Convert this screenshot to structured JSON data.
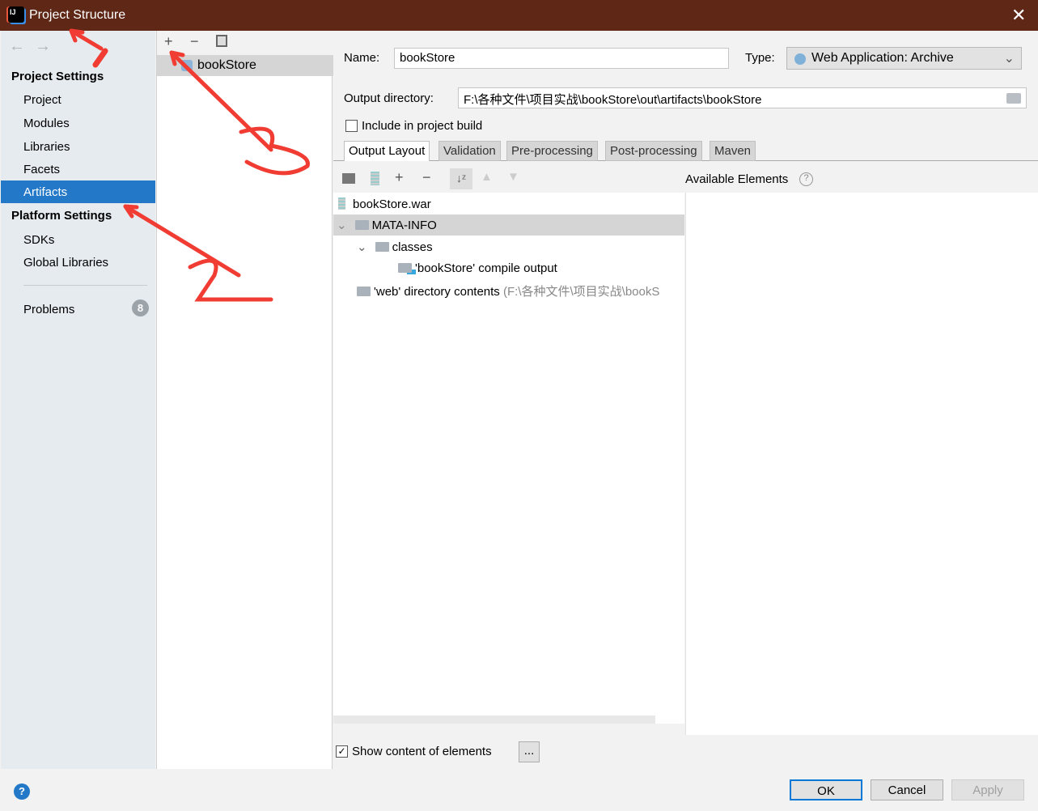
{
  "window": {
    "title": "Project Structure",
    "logo_text": "IJ"
  },
  "nav": {
    "back_icon": "arrow-left-icon",
    "forward_icon": "arrow-right-icon"
  },
  "sidebar": {
    "project_settings": "Project Settings",
    "project_items": [
      {
        "label": "Project"
      },
      {
        "label": "Modules"
      },
      {
        "label": "Libraries"
      },
      {
        "label": "Facets"
      },
      {
        "label": "Artifacts",
        "selected": true
      }
    ],
    "platform_settings": "Platform Settings",
    "platform_items": [
      {
        "label": "SDKs"
      },
      {
        "label": "Global Libraries"
      }
    ],
    "problems": {
      "label": "Problems",
      "count": "8"
    }
  },
  "artifacts_list": {
    "items": [
      {
        "label": "bookStore",
        "selected": true
      }
    ]
  },
  "artifact": {
    "name_label": "Name:",
    "name_value": "bookStore",
    "type_label": "Type:",
    "type_value": "Web Application: Archive",
    "output_dir_label": "Output directory:",
    "output_dir_value": "F:\\各种文件\\项目实战\\bookStore\\out\\artifacts\\bookStore",
    "include_build_label": "Include in project build",
    "include_build_checked": false
  },
  "tabs": [
    {
      "label": "Output Layout",
      "selected": true
    },
    {
      "label": "Validation"
    },
    {
      "label": "Pre-processing"
    },
    {
      "label": "Post-processing"
    },
    {
      "label": "Maven"
    }
  ],
  "layout": {
    "available_elements": "Available Elements",
    "tree": [
      {
        "label": "bookStore.war"
      },
      {
        "label": "MATA-INFO",
        "selected": true,
        "expanded": true
      },
      {
        "label": "classes",
        "expanded": true
      },
      {
        "label": "'bookStore' compile output"
      },
      {
        "label": "'web' directory contents",
        "hint": "(F:\\各种文件\\项目实战\\bookS"
      }
    ],
    "show_content_label": "Show content of elements",
    "show_content_checked": true,
    "more_button": "..."
  },
  "buttons": {
    "ok": "OK",
    "cancel": "Cancel",
    "apply": "Apply"
  },
  "colors": {
    "title_bar": "#5e2716",
    "selection": "#2379c8",
    "annotation": "#f03c32"
  }
}
